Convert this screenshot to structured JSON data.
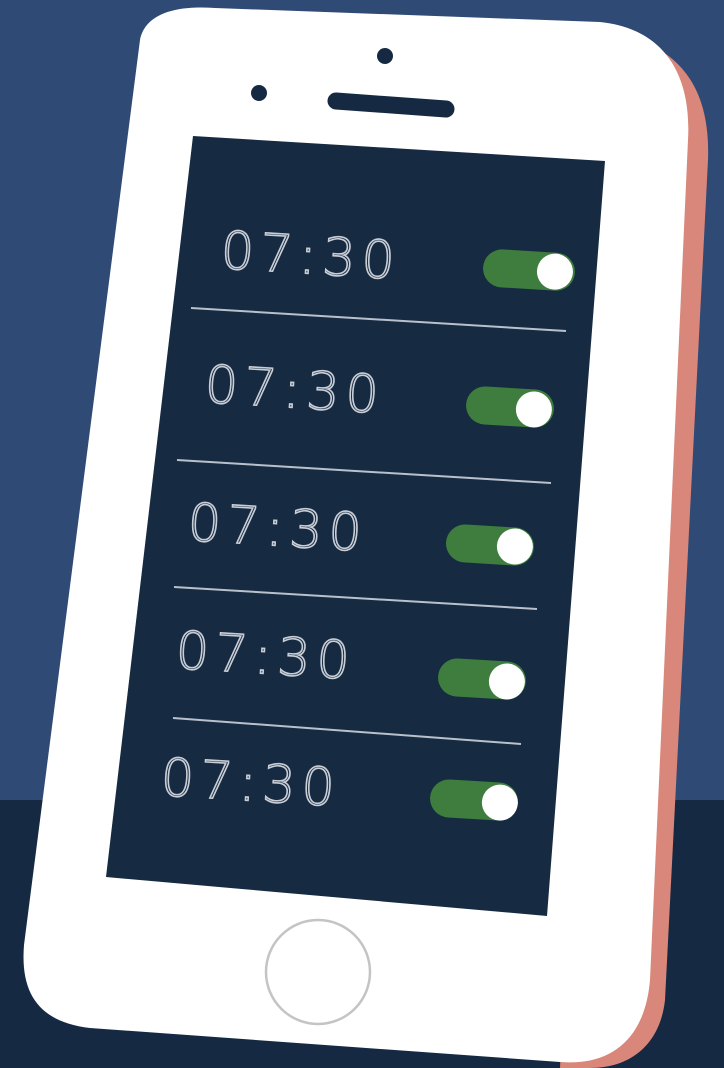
{
  "colors": {
    "wall": "#2f4a74",
    "floor": "#152a42",
    "phone_body": "#ffffff",
    "phone_edge": "#d8877a",
    "screen": "#162a42",
    "divider": "#b9c1cc",
    "time_text": "#c9ced6",
    "toggle_on": "#3e7d3e",
    "toggle_knob": "#ffffff",
    "home_button_ring": "#c4c4c4"
  },
  "alarms": [
    {
      "time": "07:30",
      "enabled": true
    },
    {
      "time": "07:30",
      "enabled": true
    },
    {
      "time": "07:30",
      "enabled": true
    },
    {
      "time": "07:30",
      "enabled": true
    },
    {
      "time": "07:30",
      "enabled": true
    }
  ],
  "icons": {
    "front_camera": "camera-dot-icon",
    "proximity_sensor": "sensor-dot-icon",
    "speaker": "earpiece-speaker-icon",
    "home_button": "home-button-icon",
    "toggle": "toggle-switch-icon"
  }
}
